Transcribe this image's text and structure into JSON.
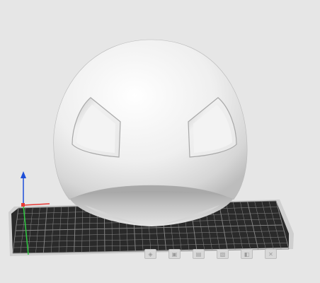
{
  "scene": {
    "background": "#e6e6e6",
    "bed": {
      "plate_color": "#2a2a2a",
      "grid_color": "#8a8a8a",
      "frame_color": "#cfcfcf"
    },
    "model": {
      "name": "",
      "color": "#f2f2f2",
      "shade_color": "#c9c9c9"
    },
    "axes": {
      "x_color": "#e53935",
      "y_color": "#2ecc40",
      "z_color": "#1e4fd8"
    }
  },
  "view_buttons": [
    {
      "icon": "view-iso-icon",
      "glyph": "◈"
    },
    {
      "icon": "view-top-icon",
      "glyph": "▣"
    },
    {
      "icon": "view-front-icon",
      "glyph": "▤"
    },
    {
      "icon": "view-side-icon",
      "glyph": "▧"
    },
    {
      "icon": "view-right-icon",
      "glyph": "◧"
    },
    {
      "icon": "view-close-icon",
      "glyph": "✕"
    }
  ]
}
